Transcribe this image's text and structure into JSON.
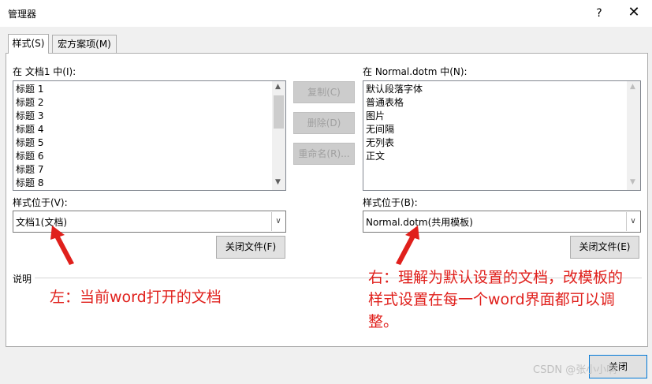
{
  "window": {
    "title": "管理器",
    "help": "?",
    "close": "✕"
  },
  "tabs": [
    {
      "label": "样式(S)"
    },
    {
      "label": "宏方案项(M)"
    }
  ],
  "left": {
    "list_label": "在 文档1 中(I):",
    "items": [
      "标题 1",
      "标题 2",
      "标题 3",
      "标题 4",
      "标题 5",
      "标题 6",
      "标题 7",
      "标题 8"
    ],
    "available_label": "样式位于(V):",
    "combo_value": "文档1(文档)",
    "close_file_button": "关闭文件(F)"
  },
  "middle": {
    "copy_button": "复制(C)",
    "delete_button": "删除(D)",
    "rename_button": "重命名(R)..."
  },
  "right": {
    "list_label": "在 Normal.dotm 中(N):",
    "items": [
      "默认段落字体",
      "普通表格",
      "图片",
      "无间隔",
      "无列表",
      "正文"
    ],
    "available_label": "样式位于(B):",
    "combo_value": "Normal.dotm(共用模板)",
    "close_file_button": "关闭文件(E)"
  },
  "description_label": "说明",
  "annotations": {
    "left_note": "左：当前word打开的文档",
    "right_note_line1": "右：理解为默认设置的文档，改模板的",
    "right_note_line2": "样式设置在每一个word界面都可以调",
    "right_note_line3": "整。",
    "color": "#e0201c"
  },
  "footer": {
    "close_button": "关闭",
    "watermark": "CSDN @张小小啊"
  }
}
